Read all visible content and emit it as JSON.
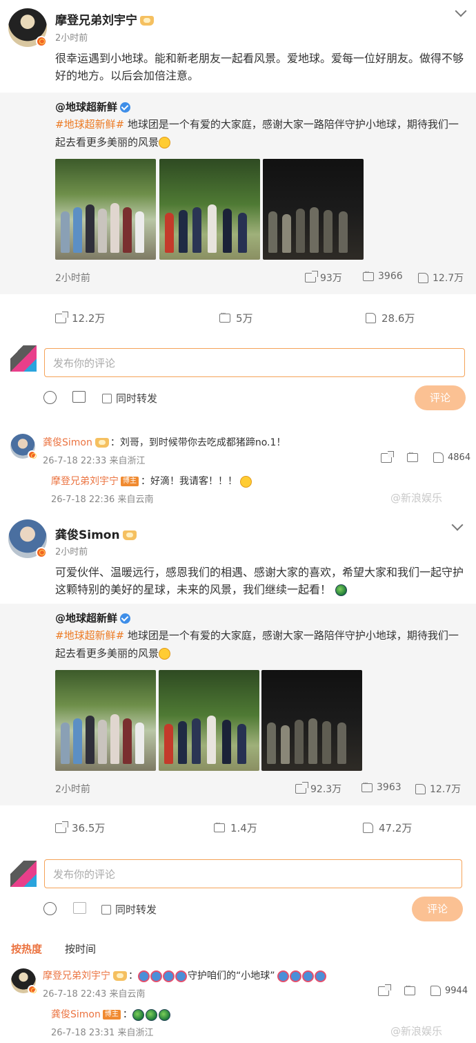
{
  "posts": [
    {
      "author": "摩登兄弟刘宇宁",
      "time": "2小时前",
      "text": "很幸运遇到小地球。能和新老朋友一起看风景。爱地球。爱每一位好朋友。做得不够好的地方。以后会加倍注意。",
      "repost": {
        "author": "@地球超新鲜",
        "hashtag": "#地球超新鲜#",
        "text": " 地球团是一个有爱的大家庭，感谢大家一路陪伴守护小地球，期待我们一起去看更多美丽的风景",
        "time": "2小时前",
        "reposts": "93万",
        "comments": "3966",
        "likes": "12.7万"
      },
      "actions": {
        "repost": "12.2万",
        "comment": "5万",
        "like": "28.6万"
      },
      "comment_box": {
        "placeholder": "发布你的评论",
        "also_repost": "同时转发",
        "submit": "评论"
      },
      "top_comment": {
        "author": "龚俊Simon",
        "text": "：刘哥，到时候带你去吃成都猪蹄no.1！",
        "meta": "26-7-18 22:33 来自浙江",
        "likes": "4864",
        "reply": {
          "author": "摩登兄弟刘宇宁",
          "badge": "博主",
          "text": "：好滴！我请客！！！",
          "meta": "26-7-18 22:36 来自云南"
        }
      }
    },
    {
      "author": "龚俊Simon",
      "time": "2小时前",
      "text": "可爱伙伴、温暖远行，感恩我们的相遇、感谢大家的喜欢，希望大家和我们一起守护这颗特别的美好的星球，未来的风景，我们继续一起看！",
      "repost": {
        "author": "@地球超新鲜",
        "hashtag": "#地球超新鲜#",
        "text": " 地球团是一个有爱的大家庭，感谢大家一路陪伴守护小地球，期待我们一起去看更多美丽的风景",
        "time": "2小时前",
        "reposts": "92.3万",
        "comments": "3963",
        "likes": "12.7万"
      },
      "actions": {
        "repost": "36.5万",
        "comment": "1.4万",
        "like": "47.2万"
      },
      "comment_box": {
        "placeholder": "发布你的评论",
        "also_repost": "同时转发",
        "submit": "评论"
      },
      "sort": {
        "hot": "按热度",
        "time": "按时间"
      },
      "top_comment": {
        "author": "摩登兄弟刘宇宁",
        "text_suffix": "守护咱们的“小地球”",
        "meta": "26-7-18 22:43 来自云南",
        "likes": "9944",
        "reply": {
          "author": "龚俊Simon",
          "badge": "博主",
          "text": "：",
          "meta": "26-7-18 23:31 来自浙江"
        }
      }
    }
  ],
  "watermark": "@新浪娱乐",
  "colors": {
    "accent": "#eb7340",
    "hashtag": "#ec7a23",
    "submit_bg": "#fbc193",
    "repost_bg": "#f5f5f5",
    "verified": "#3e8ee8"
  }
}
